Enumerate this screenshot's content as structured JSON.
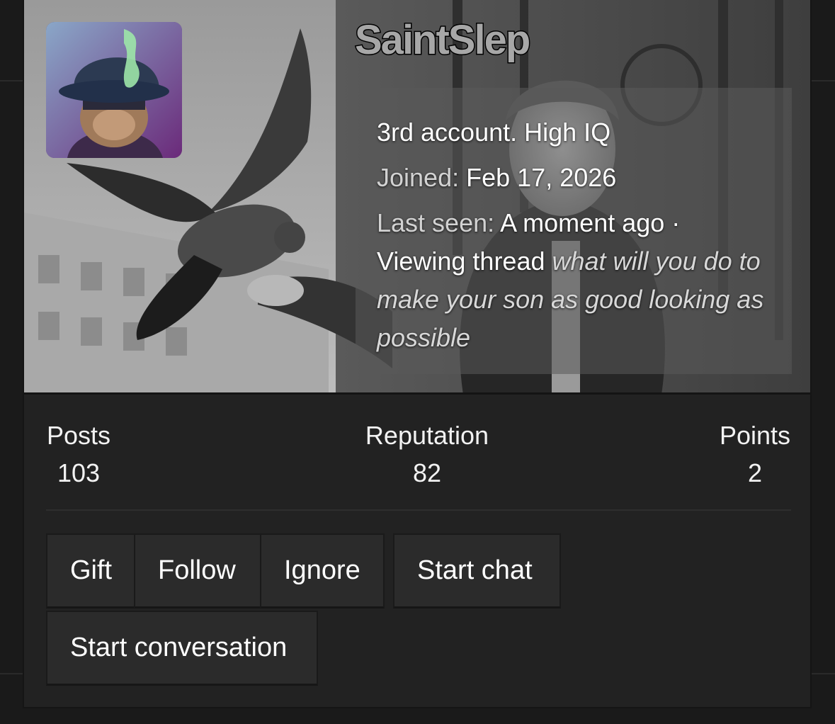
{
  "profile": {
    "username": "SaintSlep",
    "status": "3rd account. High IQ",
    "joined_label": "Joined:",
    "joined_value": "Feb 17, 2026",
    "last_seen_label": "Last seen:",
    "last_seen_value": "A moment ago",
    "separator": "·",
    "activity": "Viewing thread",
    "thread_title": "what will you do to make your son as good looking as possible"
  },
  "stats": {
    "posts_label": "Posts",
    "posts_value": "103",
    "reputation_label": "Reputation",
    "reputation_value": "82",
    "points_label": "Points",
    "points_value": "2"
  },
  "actions": {
    "gift": "Gift",
    "follow": "Follow",
    "ignore": "Ignore",
    "start_chat": "Start chat",
    "start_conversation": "Start conversation"
  },
  "colors": {
    "card_bg": "#222222",
    "button_bg": "#2b2b2b",
    "text": "#ffffff",
    "username_fill": "#a7a7a7"
  },
  "icons": {
    "avatar": "cat-in-fedora-avatar",
    "banner": "pigeon-photo-banner"
  }
}
